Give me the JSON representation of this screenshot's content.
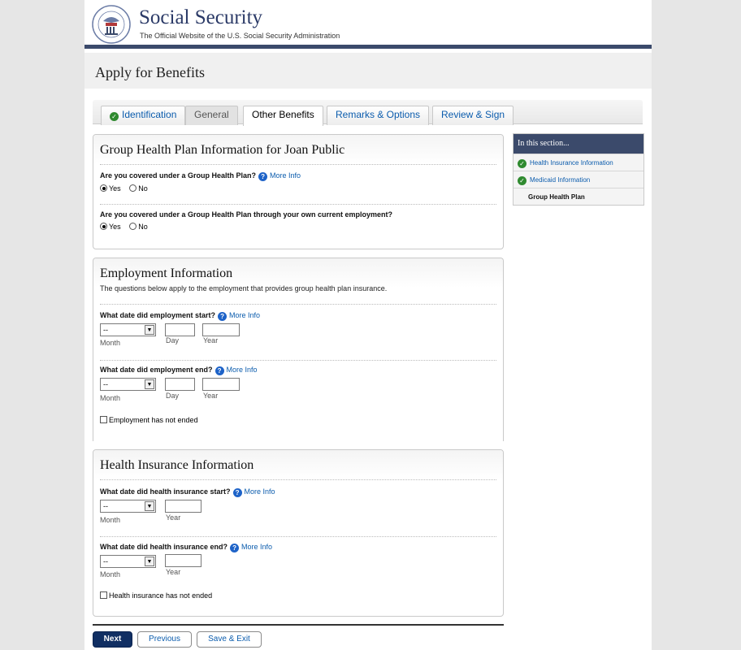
{
  "header": {
    "site_title": "Social Security",
    "site_subtitle": "The Official Website of the U.S. Social Security Administration"
  },
  "apply_title": "Apply for Benefits",
  "tabs": [
    {
      "label": "Identification",
      "state": "complete"
    },
    {
      "label": "General",
      "state": "disabled"
    },
    {
      "label": "Other Benefits",
      "state": "active"
    },
    {
      "label": "Remarks & Options",
      "state": "link"
    },
    {
      "label": "Review & Sign",
      "state": "link"
    }
  ],
  "group_health": {
    "title": "Group Health Plan Information for Joan Public",
    "q1": "Are you covered under a Group Health Plan?",
    "q2": "Are you covered under a Group Health Plan through your own current employment?",
    "more_info": "More Info",
    "yes_label": "Yes",
    "no_label": "No",
    "q1_selected": "Yes",
    "q2_selected": "Yes"
  },
  "employment": {
    "title": "Employment Information",
    "description": "The questions below apply to the employment that provides group health plan insurance.",
    "start_q": "What date did employment start?",
    "end_q": "What date did employment end?",
    "more_info": "More Info",
    "month_value": "--",
    "month_label": "Month",
    "day_label": "Day",
    "year_label": "Year",
    "not_ended_label": "Employment has not ended"
  },
  "insurance": {
    "title": "Health Insurance Information",
    "start_q": "What date did health insurance start?",
    "end_q": "What date did health insurance end?",
    "more_info": "More Info",
    "month_value": "--",
    "month_label": "Month",
    "year_label": "Year",
    "not_ended_label": "Health insurance has not ended"
  },
  "sidebar": {
    "heading": "In this section...",
    "items": [
      {
        "label": "Health Insurance Information",
        "state": "complete"
      },
      {
        "label": "Medicaid Information",
        "state": "complete"
      },
      {
        "label": "Group Health Plan",
        "state": "current"
      }
    ]
  },
  "footer": {
    "next_label": "Next",
    "previous_label": "Previous",
    "save_exit_label": "Save & Exit"
  },
  "colors": {
    "brand_navy": "#3b4a6b",
    "link_blue": "#0b5cad",
    "check_green": "#2f8a2f",
    "primary_button": "#112f63"
  }
}
